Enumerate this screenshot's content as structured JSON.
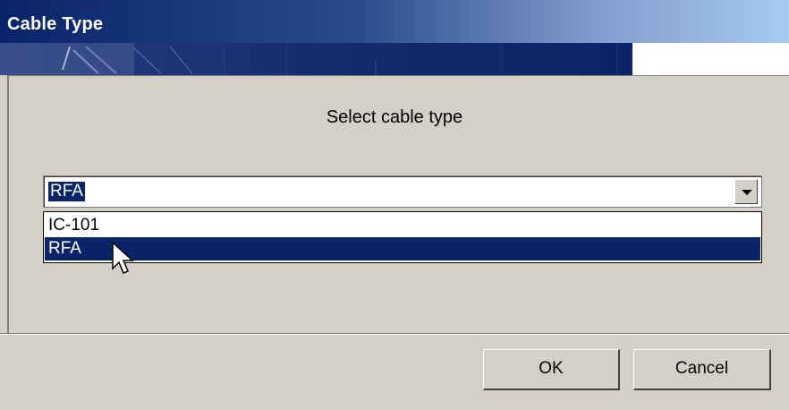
{
  "window": {
    "title": "Cable Type"
  },
  "dialog": {
    "prompt": "Select cable type",
    "combo": {
      "selected_value": "RFA"
    },
    "dropdown": {
      "options": [
        "IC-101",
        "RFA"
      ],
      "highlighted": "RFA"
    }
  },
  "buttons": {
    "ok_label": "OK",
    "cancel_label": "Cancel"
  },
  "colors": {
    "selection": "#0a246a",
    "face": "#d4d0c8",
    "window": "#ffffff"
  },
  "icons": {
    "cursor": "arrow-cursor-icon",
    "dropdown": "chevron-down-icon"
  }
}
